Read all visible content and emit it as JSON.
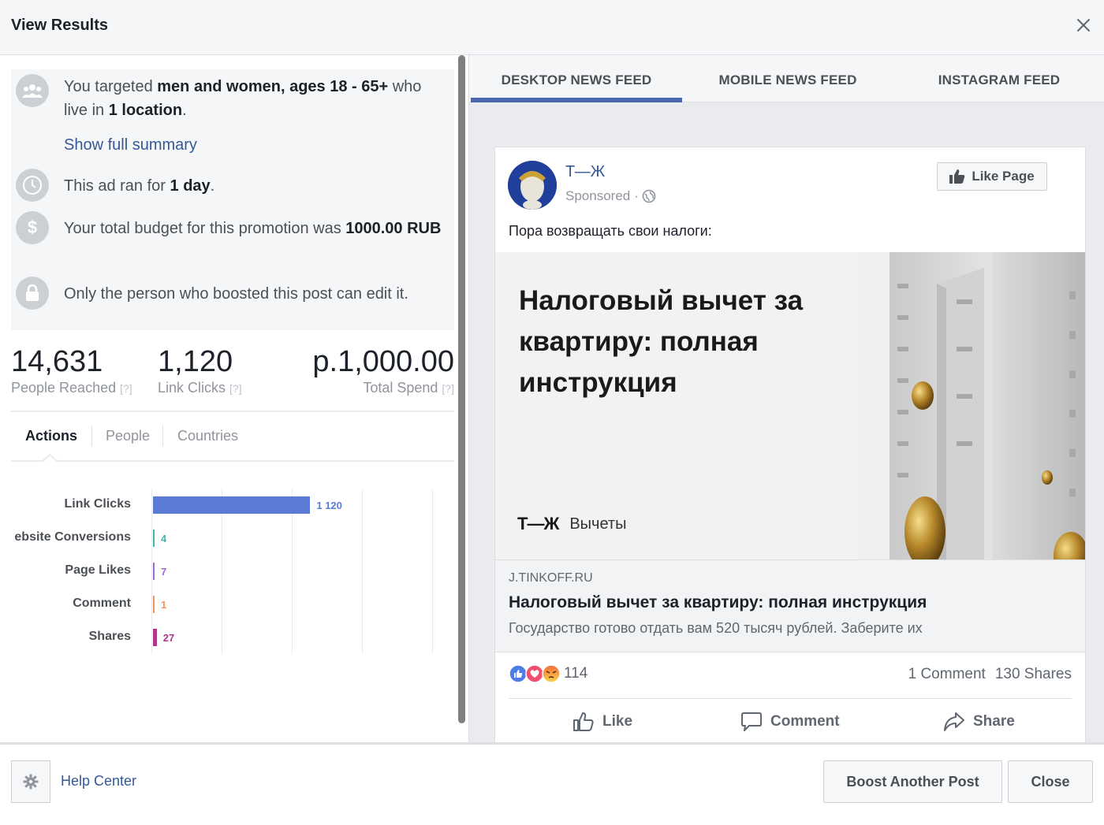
{
  "header": {
    "title": "View Results"
  },
  "summary": {
    "audience": {
      "pre": "You targeted ",
      "who": "men and women, ages 18 - 65+",
      "mid": " who live in ",
      "loc": "1 location",
      "post": "."
    },
    "show_full": "Show full summary",
    "duration": {
      "pre": "This ad ran for ",
      "val": "1 day",
      "post": "."
    },
    "budget": {
      "pre": "Your total budget for this promotion was ",
      "val": "1000.00 RUB"
    },
    "edit": "Only the person who boosted this post can edit it."
  },
  "metrics": [
    {
      "value": "14,631",
      "label": "People Reached",
      "q": "[?]"
    },
    {
      "value": "1,120",
      "label": "Link Clicks",
      "q": "[?]"
    },
    {
      "value": "р.1,000.00",
      "label": "Total Spend",
      "q": "[?]"
    }
  ],
  "tabs": [
    "Actions",
    "People",
    "Countries"
  ],
  "chart_data": {
    "type": "bar",
    "categories": [
      "Link Clicks",
      "ebsite Conversions",
      "Page Likes",
      "Comment",
      "Shares"
    ],
    "values": [
      1120,
      4,
      7,
      1,
      27
    ],
    "value_labels": [
      "1 120",
      "4",
      "7",
      "1",
      "27"
    ],
    "colors": [
      "#5b7bd5",
      "#42b5a8",
      "#9c6ad4",
      "#f0945a",
      "#b0368a"
    ],
    "xlim": [
      0,
      2000
    ],
    "orientation": "horizontal",
    "grid": true
  },
  "feed_tabs": [
    "DESKTOP NEWS FEED",
    "MOBILE NEWS FEED",
    "INSTAGRAM FEED"
  ],
  "post": {
    "page_name": "Т—Ж",
    "sponsored": "Sponsored ·",
    "like_page": "Like Page",
    "text": "Пора возвращать свои налоги:",
    "image_title": "Налоговый вычет за квартиру: полная инструкция",
    "image_logo": "Т—Ж",
    "image_tag": "Вычеты",
    "link_domain": "J.TINKOFF.RU",
    "link_title": "Налоговый вычет за квартиру: полная инструкция",
    "link_desc": "Государство готово отдать вам 520 тысяч рублей. Заберите их",
    "reactions": "114",
    "comments": "1 Comment",
    "shares": "130 Shares",
    "actions": {
      "like": "Like",
      "comment": "Comment",
      "share": "Share"
    }
  },
  "footer": {
    "help": "Help Center",
    "boost": "Boost Another Post",
    "close": "Close"
  }
}
